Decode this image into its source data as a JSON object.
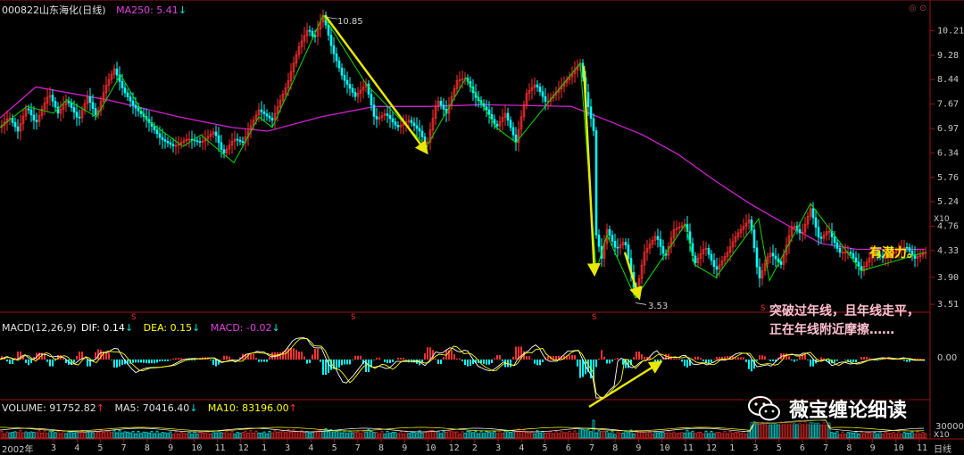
{
  "price_panel": {
    "code": "000822",
    "name": "山东海化(日线)",
    "ma_label": "MA250: 5.41",
    "ma_arrow": "↓",
    "peak_label": "10.85",
    "low_label": "3.53",
    "y_ticks": [
      "10.21",
      "9.28",
      "8.44",
      "7.67",
      "6.97",
      "6.34",
      "5.76",
      "5.24",
      "4.76",
      "4.33",
      "3.90",
      "3.51"
    ],
    "scale_tag": "X10",
    "annotation_potential": "有潜力。",
    "annotation_line1": "突破过年线，且年线走平，",
    "annotation_line2": "正在年线附近摩擦……"
  },
  "macd_panel": {
    "title": "MACD(12,26,9)",
    "dif_label": "DIF: 0.14",
    "dif_arrow": "↓",
    "dea_label": "DEA: 0.15",
    "dea_arrow": "↓",
    "macd_label": "MACD: -0.02",
    "macd_arrow": "↓",
    "zero_tick": "0.00"
  },
  "volume_panel": {
    "volume_label": "VOLUME: 91752.82",
    "volume_arrow": "↑",
    "ma5_label": "MA5: 70416.40",
    "ma5_arrow": "↓",
    "ma10_label": "MA10: 83196.00",
    "ma10_arrow": "↑",
    "tick_30000": "30000",
    "tag_x10": "X10"
  },
  "x_axis": {
    "year_label": "2002年",
    "months": [
      "3",
      "4",
      "5",
      "7",
      "8",
      "9",
      "10",
      "11",
      "12",
      "1",
      "3",
      "4",
      "5",
      "7",
      "8",
      "9",
      "10",
      "12",
      "2",
      "3",
      "4",
      "5",
      "6",
      "7",
      "8",
      "9",
      "10",
      "11",
      "12",
      "1",
      "3",
      "5",
      "6",
      "7",
      "8",
      "9",
      "10",
      "11"
    ],
    "period": "日线"
  },
  "watermark": {
    "brand": "薇宝缠论细读"
  },
  "colors": {
    "up": "#ff3030",
    "down": "#00ffff",
    "ma250": "#d020d0",
    "trendline": "#e8e800",
    "zigzag": "#00dd00",
    "white_line": "#ffffff",
    "yellow_line": "#ffff00"
  },
  "chart_data": [
    {
      "type": "line",
      "title": "000822 山东海化(日线)",
      "y_ticks": [
        10.21,
        9.28,
        8.44,
        7.67,
        6.97,
        6.34,
        5.76,
        5.24,
        4.76,
        4.33,
        3.9,
        3.51
      ],
      "ylim": [
        3.45,
        11.2
      ],
      "log_scale": true,
      "series": [
        {
          "name": "MA250",
          "last_value": 5.41
        }
      ],
      "key_points": [
        {
          "label": "peak",
          "value": 10.85
        },
        {
          "label": "low",
          "value": 3.53
        }
      ]
    },
    {
      "type": "bar",
      "title": "MACD(12,26,9)",
      "series": [
        {
          "name": "DIF",
          "last_value": 0.14
        },
        {
          "name": "DEA",
          "last_value": 0.15
        },
        {
          "name": "MACD",
          "last_value": -0.02
        }
      ],
      "y_ticks": [
        0.0
      ]
    },
    {
      "type": "bar",
      "title": "VOLUME",
      "series": [
        {
          "name": "VOLUME",
          "last_value": 91752.82
        },
        {
          "name": "MA5",
          "last_value": 70416.4
        },
        {
          "name": "MA10",
          "last_value": 83196.0
        }
      ],
      "y_ticks": [
        30000
      ]
    }
  ]
}
